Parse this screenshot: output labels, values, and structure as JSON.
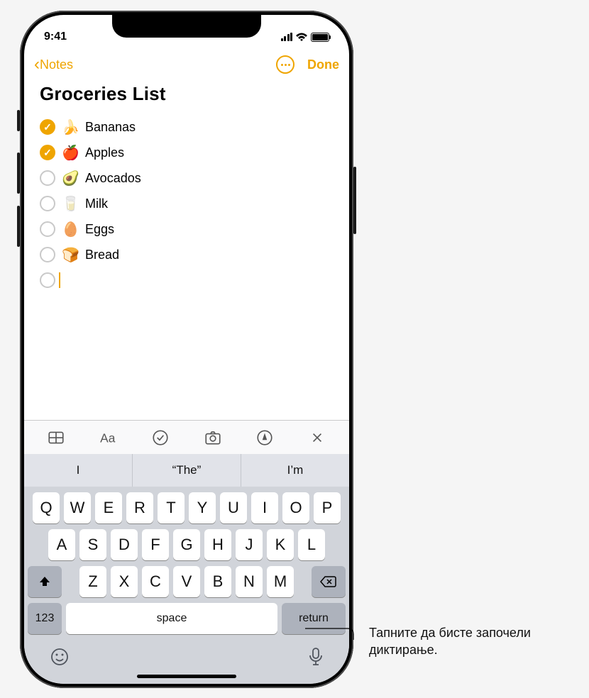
{
  "status": {
    "time": "9:41"
  },
  "nav": {
    "back": "Notes",
    "done": "Done"
  },
  "note": {
    "title": "Groceries List",
    "items": [
      {
        "checked": true,
        "emoji": "🍌",
        "text": "Bananas"
      },
      {
        "checked": true,
        "emoji": "🍎",
        "text": "Apples"
      },
      {
        "checked": false,
        "emoji": "🥑",
        "text": "Avocados"
      },
      {
        "checked": false,
        "emoji": "🥛",
        "text": "Milk"
      },
      {
        "checked": false,
        "emoji": "🥚",
        "text": "Eggs"
      },
      {
        "checked": false,
        "emoji": "🍞",
        "text": "Bread"
      }
    ]
  },
  "suggestions": {
    "s1": "I",
    "s2": "The",
    "s3": "I’m"
  },
  "keyboard": {
    "row1": [
      "Q",
      "W",
      "E",
      "R",
      "T",
      "Y",
      "U",
      "I",
      "O",
      "P"
    ],
    "row2": [
      "A",
      "S",
      "D",
      "F",
      "G",
      "H",
      "J",
      "K",
      "L"
    ],
    "row3": [
      "Z",
      "X",
      "C",
      "V",
      "B",
      "N",
      "M"
    ],
    "numKey": "123",
    "space": "space",
    "return": "return"
  },
  "callout": "Тапните да бисте започели диктирање."
}
